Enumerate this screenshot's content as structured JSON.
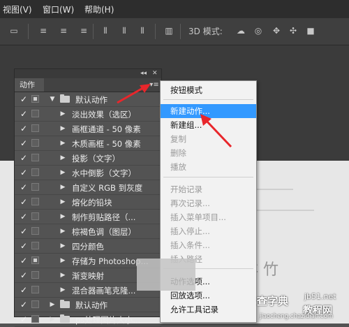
{
  "menubar": {
    "items": [
      {
        "label": "视图(V)"
      },
      {
        "label": "窗口(W)"
      },
      {
        "label": "帮助(H)"
      }
    ]
  },
  "options_bar": {
    "mode_3d_label": "3D 模式:",
    "icons": [
      "align-top-icon",
      "align-vcenter-icon",
      "align-bottom-icon",
      "align-left-icon",
      "align-hcenter-icon",
      "align-right-icon",
      "distribute-icon",
      "3d-rotate-icon",
      "3d-roll-icon",
      "3d-drag-icon",
      "3d-slide-icon",
      "3d-scale-icon"
    ]
  },
  "actions_panel": {
    "collapse_glyph": "◂◂",
    "close_glyph": "✕",
    "tab_label": "动作",
    "menu_glyph": "▾≡",
    "rows": [
      {
        "check": "✓",
        "dialog": true,
        "level": 0,
        "expanded": true,
        "type": "set",
        "name": "默认动作"
      },
      {
        "check": "✓",
        "dialog": false,
        "level": 1,
        "expanded": false,
        "type": "action",
        "name": "淡出效果（选区）"
      },
      {
        "check": "✓",
        "dialog": false,
        "level": 1,
        "expanded": false,
        "type": "action",
        "name": "画框通道 - 50 像素"
      },
      {
        "check": "✓",
        "dialog": false,
        "level": 1,
        "expanded": false,
        "type": "action",
        "name": "木质画框 - 50 像素"
      },
      {
        "check": "✓",
        "dialog": false,
        "level": 1,
        "expanded": false,
        "type": "action",
        "name": "投影（文字）"
      },
      {
        "check": "✓",
        "dialog": false,
        "level": 1,
        "expanded": false,
        "type": "action",
        "name": "水中倒影（文字）"
      },
      {
        "check": "✓",
        "dialog": false,
        "level": 1,
        "expanded": false,
        "type": "action",
        "name": "自定义 RGB 到灰度"
      },
      {
        "check": "✓",
        "dialog": false,
        "level": 1,
        "expanded": false,
        "type": "action",
        "name": "熔化的铅块"
      },
      {
        "check": "✓",
        "dialog": false,
        "level": 1,
        "expanded": false,
        "type": "action",
        "name": "制作剪贴路径（..."
      },
      {
        "check": "✓",
        "dialog": false,
        "level": 1,
        "expanded": false,
        "type": "action",
        "name": "棕褐色调（图层）"
      },
      {
        "check": "✓",
        "dialog": false,
        "level": 1,
        "expanded": false,
        "type": "action",
        "name": "四分颜色"
      },
      {
        "check": "✓",
        "dialog": true,
        "level": 1,
        "expanded": false,
        "type": "action",
        "name": "存储为 Photoshop..."
      },
      {
        "check": "✓",
        "dialog": false,
        "level": 1,
        "expanded": false,
        "type": "action",
        "name": "渐变映射"
      },
      {
        "check": "✓",
        "dialog": false,
        "level": 1,
        "expanded": false,
        "type": "action",
        "name": "混合器画笔克隆..."
      },
      {
        "check": "✓",
        "dialog": false,
        "level": 0,
        "expanded": false,
        "type": "set",
        "name": "默认动作"
      },
      {
        "check": "✓",
        "dialog": false,
        "level": 0,
        "expanded": false,
        "type": "set",
        "name": "ps处理图片大小..."
      }
    ]
  },
  "context_menu": {
    "items": [
      {
        "label": "按钮模式",
        "enabled": true,
        "highlighted": false
      },
      {
        "label": "新建动作...",
        "enabled": true,
        "highlighted": true
      },
      {
        "label": "新建组...",
        "enabled": true,
        "highlighted": false
      },
      {
        "label": "复制",
        "enabled": false,
        "highlighted": false
      },
      {
        "label": "删除",
        "enabled": false,
        "highlighted": false
      },
      {
        "label": "播放",
        "enabled": false,
        "highlighted": false
      },
      {
        "label": "开始记录",
        "enabled": false,
        "highlighted": false
      },
      {
        "label": "再次记录...",
        "enabled": false,
        "highlighted": false
      },
      {
        "label": "插入菜单项目...",
        "enabled": false,
        "highlighted": false
      },
      {
        "label": "插入停止...",
        "enabled": false,
        "highlighted": false
      },
      {
        "label": "插入条件...",
        "enabled": false,
        "highlighted": false
      },
      {
        "label": "插入路径",
        "enabled": false,
        "highlighted": false
      },
      {
        "label": "动作选项...",
        "enabled": true,
        "highlighted": false
      },
      {
        "label": "回放选项...",
        "enabled": true,
        "highlighted": false
      },
      {
        "label": "允许工具记录",
        "enabled": true,
        "highlighted": false
      }
    ]
  },
  "watermark": {
    "line1": "查字典",
    "line2": "教程网",
    "line3": "jiaocheng.chazidian.com",
    "corner": "jb51.net"
  },
  "colors": {
    "highlight": "#3399ff",
    "annotation_arrow": "#e8262b",
    "panel_bg": "#535353",
    "menubar_bg": "#2d2d2d"
  }
}
